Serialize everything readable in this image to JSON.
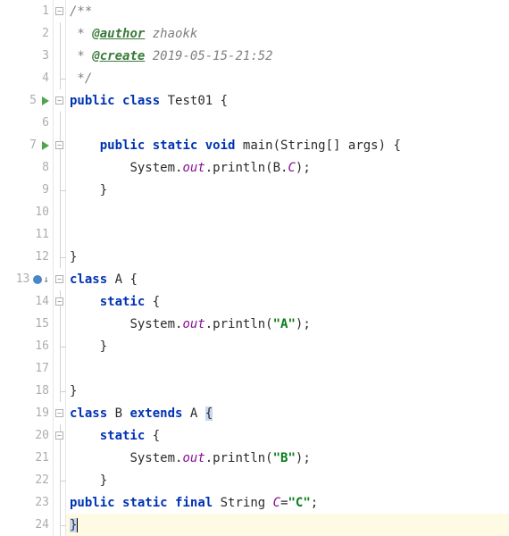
{
  "gutter": {
    "lines": [
      "1",
      "2",
      "3",
      "4",
      "5",
      "6",
      "7",
      "8",
      "9",
      "10",
      "11",
      "12",
      "13",
      "14",
      "15",
      "16",
      "17",
      "18",
      "19",
      "20",
      "21",
      "22",
      "23",
      "24"
    ],
    "runnable": [
      5,
      7
    ],
    "breakpoint": 13
  },
  "code": {
    "l1": {
      "c1": "/**"
    },
    "l2": {
      "c1": " * ",
      "tag": "@author",
      "val": " zhaokk"
    },
    "l3": {
      "c1": " * ",
      "tag": "@create",
      "val": " 2019-05-15-21:52"
    },
    "l4": {
      "c1": " */"
    },
    "l5": {
      "k1": "public",
      "k2": "class",
      "name": " Test01 {"
    },
    "l6": {
      "blank": ""
    },
    "l7": {
      "indent": "    ",
      "k1": "public",
      "k2": "static",
      "k3": "void",
      "name": " main(String[] args) {"
    },
    "l8": {
      "indent": "        ",
      "t1": "System.",
      "fld1": "out",
      "t2": ".println(B.",
      "fld2": "C",
      "t3": ");"
    },
    "l9": {
      "indent": "    ",
      "brace": "}"
    },
    "l10": {
      "blank": ""
    },
    "l11": {
      "blank": ""
    },
    "l12": {
      "brace": "}"
    },
    "l13": {
      "k1": "class",
      "name": " A {"
    },
    "l14": {
      "indent": "    ",
      "k1": "static",
      "brace": " {"
    },
    "l15": {
      "indent": "        ",
      "t1": "System.",
      "fld1": "out",
      "t2": ".println(",
      "str": "\"A\"",
      "t3": ");"
    },
    "l16": {
      "indent": "    ",
      "brace": "}"
    },
    "l17": {
      "blank": ""
    },
    "l18": {
      "brace": "}"
    },
    "l19": {
      "k1": "class",
      "t1": " B ",
      "k2": "extends",
      "t2": " A ",
      "brace": "{"
    },
    "l20": {
      "indent": "    ",
      "k1": "static",
      "brace": " {"
    },
    "l21": {
      "indent": "        ",
      "t1": "System.",
      "fld1": "out",
      "t2": ".println(",
      "str": "\"B\"",
      "t3": ");"
    },
    "l22": {
      "indent": "    ",
      "brace": "}"
    },
    "l23": {
      "k1": "public",
      "k2": "static",
      "k3": "final",
      "t1": " String ",
      "fld": "C",
      "t2": "=",
      "str": "\"C\"",
      "t3": ";"
    },
    "l24": {
      "brace": "}"
    }
  }
}
